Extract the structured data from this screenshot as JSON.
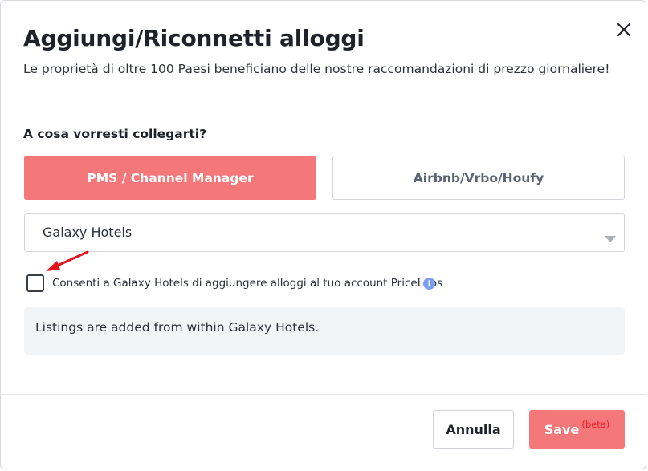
{
  "dialog": {
    "title": "Aggiungi/Riconnetti alloggi",
    "subtitle": "Le proprietà di oltre 100 Paesi beneficiano delle nostre raccomandazioni di prezzo giornaliere!",
    "close_icon": "close-icon"
  },
  "connect": {
    "question": "A cosa vorresti collegarti?",
    "options": [
      {
        "label": "PMS / Channel Manager",
        "selected": true
      },
      {
        "label": "Airbnb/Vrbo/Houfy",
        "selected": false
      }
    ]
  },
  "provider_select": {
    "value": "Galaxy Hotels",
    "icon": "caret-down-icon"
  },
  "consent": {
    "checked": false,
    "label": "Consenti a Galaxy Hotels di aggiungere alloggi al tuo account PriceLabs",
    "icon": "info-icon"
  },
  "note": {
    "text": "Listings are added from within Galaxy Hotels."
  },
  "footer": {
    "cancel_label": "Annulla",
    "save_label": "Save",
    "save_badge": "(beta)"
  },
  "colors": {
    "accent": "#f4777a",
    "badge": "#e8232a",
    "info": "#7b9ff0",
    "arrow": "#e3141b"
  }
}
